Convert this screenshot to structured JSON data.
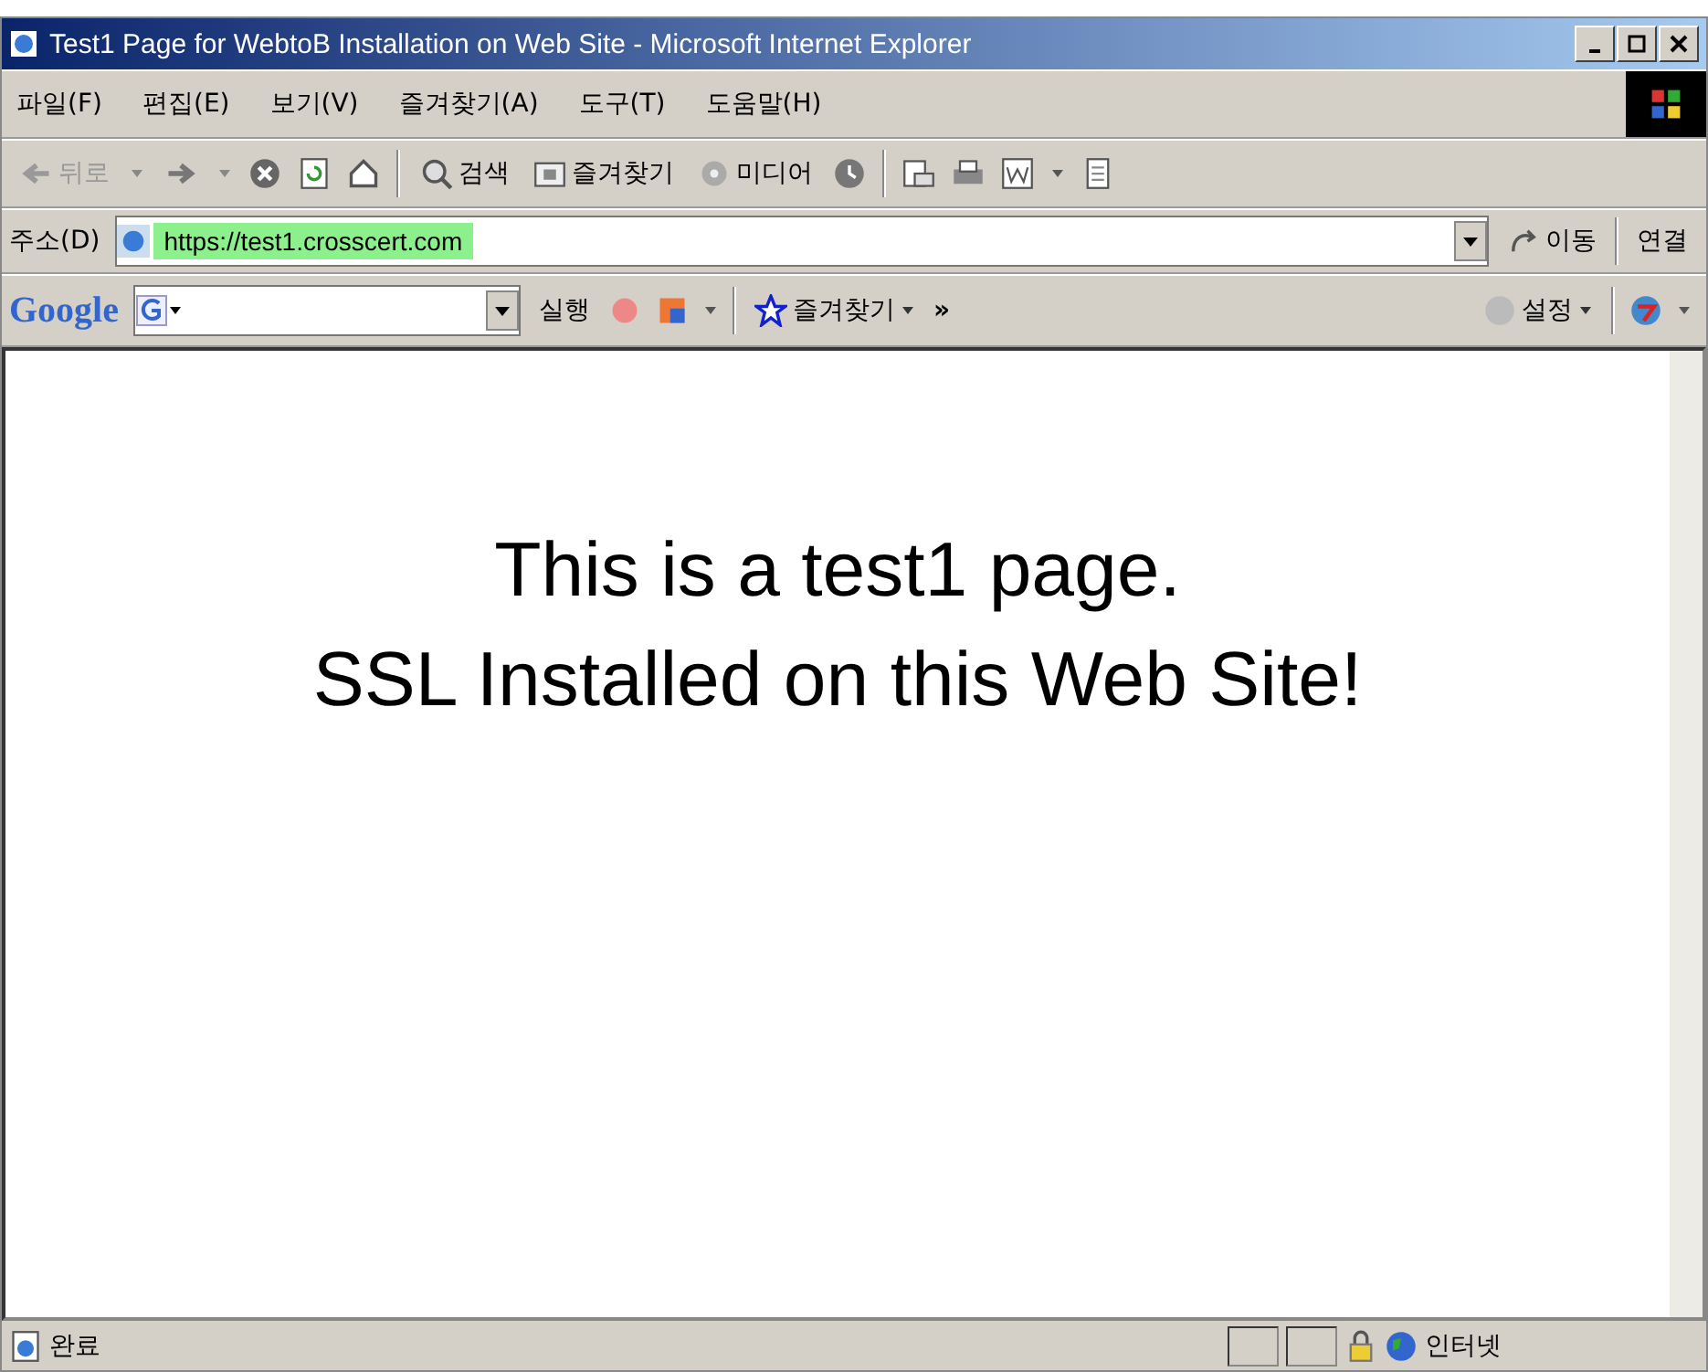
{
  "window": {
    "title": "Test1 Page for WebtoB Installation on Web Site - Microsoft Internet Explorer"
  },
  "menu": [
    "파일(F)",
    "편집(E)",
    "보기(V)",
    "즐겨찾기(A)",
    "도구(T)",
    "도움말(H)"
  ],
  "toolbar": {
    "back": "뒤로",
    "search": "검색",
    "favorites": "즐겨찾기",
    "media": "미디어"
  },
  "address": {
    "label": "주소(D)",
    "url": "https://test1.crosscert.com",
    "go": "이동",
    "links": "연결"
  },
  "google": {
    "logo": "Google",
    "run": "실행",
    "favorites": "즐겨찾기",
    "more": "»",
    "settings": "설정"
  },
  "content": [
    "This is a test1 page.",
    "SSL Installed on this Web Site!"
  ],
  "status_bar": {
    "text": "완료",
    "zone": "인터넷"
  }
}
